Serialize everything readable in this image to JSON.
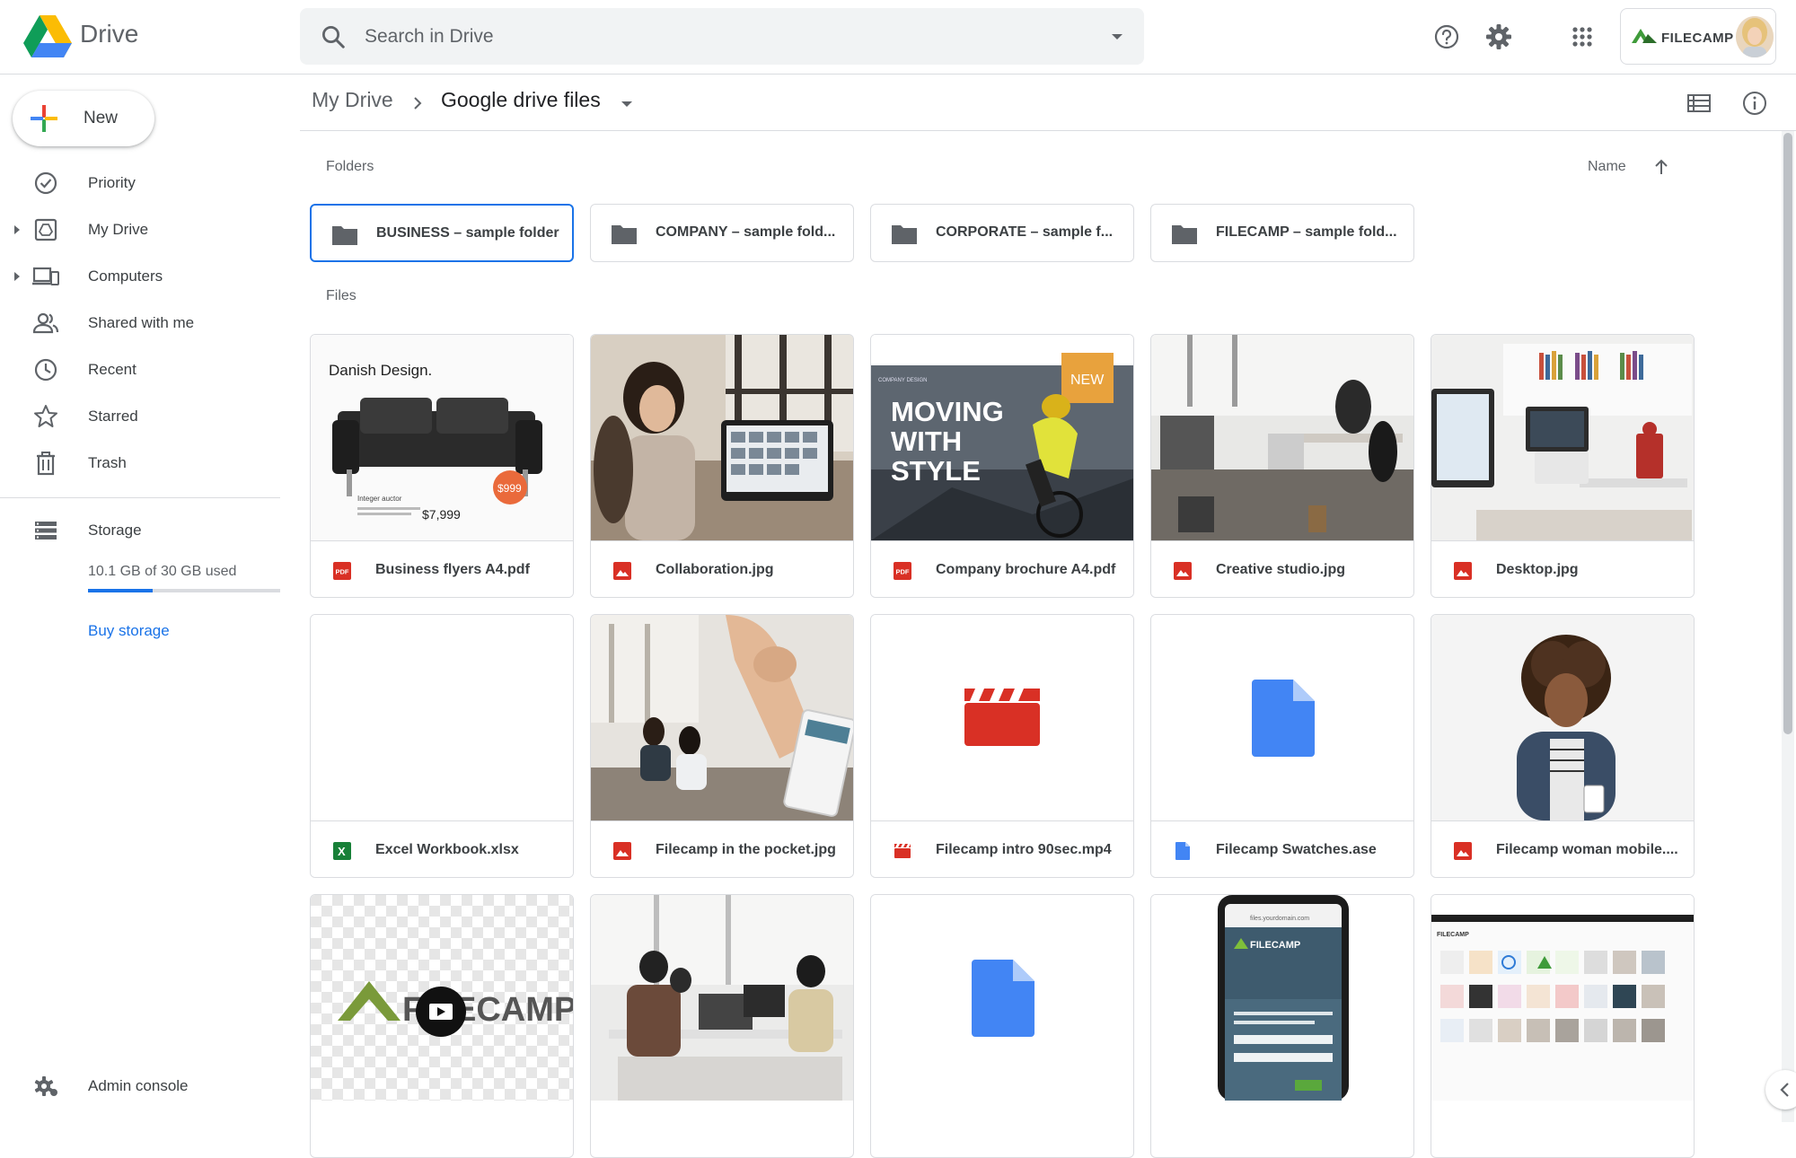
{
  "app": {
    "name": "Drive",
    "search_placeholder": "Search in Drive",
    "account_name": "FILECAMP"
  },
  "new_button": {
    "label": "New"
  },
  "sidebar": {
    "items": [
      {
        "label": "Priority",
        "icon": "priority-icon"
      },
      {
        "label": "My Drive",
        "icon": "my-drive-icon"
      },
      {
        "label": "Computers",
        "icon": "computers-icon"
      },
      {
        "label": "Shared with me",
        "icon": "shared-icon"
      },
      {
        "label": "Recent",
        "icon": "recent-icon"
      },
      {
        "label": "Starred",
        "icon": "star-icon"
      },
      {
        "label": "Trash",
        "icon": "trash-icon"
      }
    ],
    "storage": {
      "label": "Storage",
      "usage_text": "10.1 GB of 30 GB used",
      "used_fraction": 0.337,
      "buy_label": "Buy storage"
    },
    "admin_label": "Admin console"
  },
  "breadcrumb": {
    "root": "My Drive",
    "current": "Google drive files"
  },
  "sections": {
    "folders_label": "Folders",
    "files_label": "Files",
    "sort_label": "Name"
  },
  "folders": [
    {
      "name": "BUSINESS – sample folder"
    },
    {
      "name": "COMPANY – sample fold..."
    },
    {
      "name": "CORPORATE – sample f..."
    },
    {
      "name": "FILECAMP – sample fold..."
    }
  ],
  "files": [
    {
      "name": "Business flyers A4.pdf",
      "type": "pdf"
    },
    {
      "name": "Collaboration.jpg",
      "type": "image"
    },
    {
      "name": "Company brochure A4.pdf",
      "type": "pdf"
    },
    {
      "name": "Creative studio.jpg",
      "type": "image"
    },
    {
      "name": "Desktop.jpg",
      "type": "image"
    },
    {
      "name": "Excel Workbook.xlsx",
      "type": "excel"
    },
    {
      "name": "Filecamp in the pocket.jpg",
      "type": "image"
    },
    {
      "name": "Filecamp intro 90sec.mp4",
      "type": "video"
    },
    {
      "name": "Filecamp Swatches.ase",
      "type": "doc"
    },
    {
      "name": "Filecamp woman mobile....",
      "type": "image"
    }
  ],
  "thumb_text": {
    "flyer_title": "Danish Design.",
    "flyer_price": "$7,999",
    "flyer_badge": "$999",
    "flyer_small": "Integer auctor",
    "brochure_badge": "NEW",
    "brochure_headline_1": "MOVING",
    "brochure_headline_2": "WITH",
    "brochure_headline_3": "STYLE",
    "brochure_small": "COMPANY DESIGN",
    "logo_word": "FILECAMP",
    "phone_url": "files.yourdomain.com",
    "phone_brand": "FILECAMP",
    "laptop_brand": "FILECAMP"
  },
  "colors": {
    "accent": "#1a73e8",
    "pdf": "#d93025",
    "excel": "#188038",
    "doc": "#4285f4",
    "video": "#d93025"
  }
}
